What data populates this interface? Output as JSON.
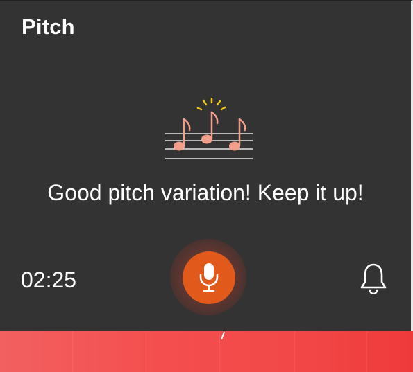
{
  "panel": {
    "title": "Pitch",
    "feedback_message": "Good pitch variation! Keep it up!",
    "timer": "02:25"
  },
  "icons": {
    "music": "music-notes-icon",
    "microphone": "microphone-icon",
    "notification": "bell-icon"
  },
  "colors": {
    "panel_background": "#333333",
    "mic_button": "#e15a1c",
    "music_notes": "#f2a08c",
    "sparkle": "#f5c518",
    "bottom_bar": "#f24848"
  }
}
